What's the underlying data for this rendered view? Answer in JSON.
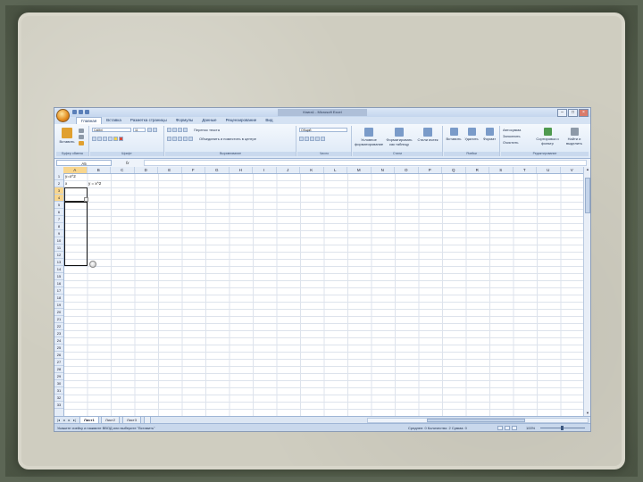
{
  "window": {
    "title": "Книга1 - Microsoft Excel",
    "controls": [
      "–",
      "□",
      "×"
    ]
  },
  "menu_tabs": [
    "Главная",
    "Вставка",
    "Разметка страницы",
    "Формулы",
    "Данные",
    "Рецензирование",
    "Вид"
  ],
  "active_tab": "Главная",
  "ribbon": {
    "clipboard": {
      "paste_label": "Вставить",
      "group_label": "Буфер обмена"
    },
    "font": {
      "font_name": "Calibri",
      "font_size": "11",
      "group_label": "Шрифт"
    },
    "alignment": {
      "wrap_label": "Перенос текста",
      "merge_label": "Объединить и поместить в центре",
      "group_label": "Выравнивание"
    },
    "number": {
      "format": "Общий",
      "group_label": "Число"
    },
    "styles": {
      "cond_label": "Условное форматирование",
      "table_label": "Форматировать как таблицу",
      "cell_label": "Стили ячеек",
      "group_label": "Стили"
    },
    "cells": {
      "insert_label": "Вставить",
      "delete_label": "Удалить",
      "format_label": "Формат",
      "group_label": "Ячейки"
    },
    "editing": {
      "sum_label": "Автосумма",
      "fill_label": "Заполнить",
      "clear_label": "Очистить",
      "sort_label": "Сортировка и фильтр",
      "find_label": "Найти и выделить",
      "group_label": "Редактирование"
    }
  },
  "formula_bar": {
    "name_box": "A5",
    "fx": "fx",
    "value": ""
  },
  "columns": [
    "A",
    "B",
    "C",
    "D",
    "E",
    "F",
    "G",
    "H",
    "I",
    "J",
    "K",
    "L",
    "M",
    "N",
    "O",
    "P",
    "Q",
    "R",
    "S",
    "T",
    "U",
    "V"
  ],
  "selected_column": "A",
  "rows": [
    "1",
    "2",
    "3",
    "4",
    "5",
    "6",
    "7",
    "8",
    "9",
    "10",
    "11",
    "12",
    "13",
    "14",
    "15",
    "16",
    "17",
    "18",
    "19",
    "20",
    "21",
    "22",
    "23",
    "24",
    "25",
    "26",
    "27",
    "28",
    "29",
    "30",
    "31",
    "32",
    "33"
  ],
  "selected_rows": [
    "3",
    "4"
  ],
  "cells": {
    "a1": "y=x^2",
    "a2": "x",
    "b2": "y = x^2"
  },
  "sheets": [
    "Лист1",
    "Лист2",
    "Лист3"
  ],
  "active_sheet": "Лист1",
  "status": {
    "message": "Укажите ячейку и нажмите ВВОД или выберите \"Вставить\"",
    "stats": "Среднее: 0   Количество: 2   Сумма: 0",
    "zoom": "100%"
  }
}
